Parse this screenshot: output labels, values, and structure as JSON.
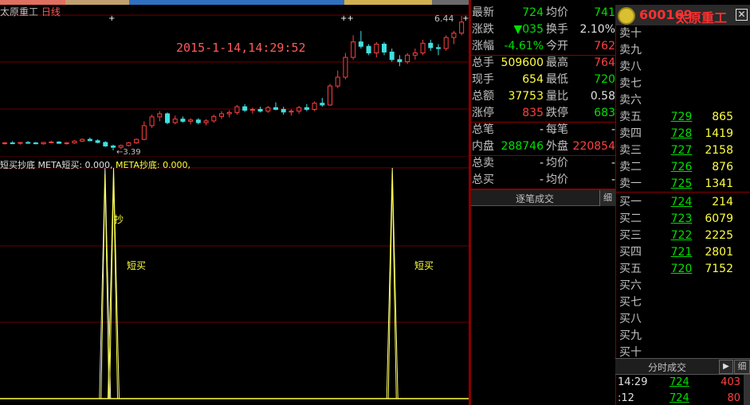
{
  "header": {
    "stock_name": "太原重工",
    "period": "日线",
    "cursor_datetime": "2015-1-14,14:29:52",
    "high_label": "6.44",
    "low_label": "3.39"
  },
  "indicator": {
    "name": "短买抄底",
    "meta_a": "META短买: 0.000,",
    "meta_b": "META抄底: 0.000,",
    "signals": [
      "抄",
      "短买",
      "短买"
    ]
  },
  "quote": {
    "rows": [
      {
        "l1": "最新",
        "v1": "724",
        "c1": "green",
        "l2": "均价",
        "v2": "741",
        "c2": "green"
      },
      {
        "l1": "涨跌",
        "v1": "▼035",
        "c1": "green",
        "l2": "换手",
        "v2": "2.10%",
        "c2": "white"
      },
      {
        "l1": "涨幅",
        "v1": "-4.61%",
        "c1": "green",
        "l2": "今开",
        "v2": "762",
        "c2": "red"
      },
      {
        "l1": "总手",
        "v1": "509600",
        "c1": "yellow",
        "l2": "最高",
        "v2": "764",
        "c2": "red"
      },
      {
        "l1": "现手",
        "v1": "654",
        "c1": "yellow",
        "l2": "最低",
        "v2": "720",
        "c2": "green"
      },
      {
        "l1": "总额",
        "v1": "37753",
        "c1": "yellow",
        "l2": "量比",
        "v2": "0.58",
        "c2": "white"
      },
      {
        "l1": "涨停",
        "v1": "835",
        "c1": "red",
        "l2": "跌停",
        "v2": "683",
        "c2": "green"
      },
      {
        "l1": "总笔",
        "v1": "-",
        "c1": "white",
        "l2": "每笔",
        "v2": "-",
        "c2": "white"
      },
      {
        "l1": "内盘",
        "v1": "288746",
        "c1": "green",
        "l2": "外盘",
        "v2": "220854",
        "c2": "red"
      },
      {
        "l1": "总卖",
        "v1": "-",
        "c1": "white",
        "l2": "均价",
        "v2": "-",
        "c2": "white"
      },
      {
        "l1": "总买",
        "v1": "-",
        "c1": "white",
        "l2": "均价",
        "v2": "-",
        "c2": "white"
      }
    ],
    "tick_title": "逐笔成交",
    "tick_detail_button": "细"
  },
  "orderbook": {
    "code": "600169",
    "name": "太原重工",
    "close_icon": "close-icon",
    "levels": [
      {
        "label": "卖十",
        "price": "",
        "vol": ""
      },
      {
        "label": "卖九",
        "price": "",
        "vol": ""
      },
      {
        "label": "卖八",
        "price": "",
        "vol": ""
      },
      {
        "label": "卖七",
        "price": "",
        "vol": ""
      },
      {
        "label": "卖六",
        "price": "",
        "vol": ""
      },
      {
        "label": "卖五",
        "price": "729",
        "vol": "865"
      },
      {
        "label": "卖四",
        "price": "728",
        "vol": "1419"
      },
      {
        "label": "卖三",
        "price": "727",
        "vol": "2158"
      },
      {
        "label": "卖二",
        "price": "726",
        "vol": "876"
      },
      {
        "label": "卖一",
        "price": "725",
        "vol": "1341"
      },
      {
        "label": "买一",
        "price": "724",
        "vol": "214"
      },
      {
        "label": "买二",
        "price": "723",
        "vol": "6079"
      },
      {
        "label": "买三",
        "price": "722",
        "vol": "2225"
      },
      {
        "label": "买四",
        "price": "721",
        "vol": "2801"
      },
      {
        "label": "买五",
        "price": "720",
        "vol": "7152"
      },
      {
        "label": "买六",
        "price": "",
        "vol": ""
      },
      {
        "label": "买七",
        "price": "",
        "vol": ""
      },
      {
        "label": "买八",
        "price": "",
        "vol": ""
      },
      {
        "label": "买九",
        "price": "",
        "vol": ""
      },
      {
        "label": "买十",
        "price": "",
        "vol": ""
      }
    ],
    "timeshare_title": "分时成交",
    "timeshare_play": "▶",
    "timeshare_detail": "细",
    "trades": [
      {
        "time": "14:29",
        "price": "724",
        "vol": "403"
      },
      {
        "time": ":12",
        "price": "724",
        "vol": "80"
      }
    ]
  },
  "chart_data": {
    "type": "candlestick",
    "title": "",
    "high": 6.44,
    "low": 3.39,
    "candles": [
      [
        3.55,
        3.58,
        3.52,
        3.56
      ],
      [
        3.56,
        3.6,
        3.53,
        3.55
      ],
      [
        3.55,
        3.58,
        3.52,
        3.57
      ],
      [
        3.57,
        3.6,
        3.54,
        3.56
      ],
      [
        3.56,
        3.58,
        3.53,
        3.54
      ],
      [
        3.54,
        3.58,
        3.52,
        3.57
      ],
      [
        3.57,
        3.61,
        3.55,
        3.58
      ],
      [
        3.58,
        3.6,
        3.54,
        3.55
      ],
      [
        3.55,
        3.58,
        3.52,
        3.56
      ],
      [
        3.56,
        3.62,
        3.54,
        3.6
      ],
      [
        3.6,
        3.66,
        3.58,
        3.64
      ],
      [
        3.64,
        3.68,
        3.6,
        3.61
      ],
      [
        3.61,
        3.64,
        3.55,
        3.57
      ],
      [
        3.57,
        3.6,
        3.47,
        3.49
      ],
      [
        3.49,
        3.52,
        3.39,
        3.46
      ],
      [
        3.46,
        3.52,
        3.42,
        3.5
      ],
      [
        3.5,
        3.58,
        3.48,
        3.56
      ],
      [
        3.56,
        3.66,
        3.54,
        3.64
      ],
      [
        3.64,
        4.05,
        3.62,
        3.95
      ],
      [
        3.95,
        4.2,
        3.9,
        4.15
      ],
      [
        4.15,
        4.28,
        4.05,
        4.22
      ],
      [
        4.22,
        4.25,
        3.98,
        4.02
      ],
      [
        4.02,
        4.18,
        3.98,
        4.1
      ],
      [
        4.1,
        4.16,
        4.02,
        4.05
      ],
      [
        4.05,
        4.12,
        3.98,
        4.08
      ],
      [
        4.08,
        4.12,
        3.98,
        4.02
      ],
      [
        4.02,
        4.1,
        3.96,
        4.06
      ],
      [
        4.06,
        4.2,
        4.02,
        4.16
      ],
      [
        4.16,
        4.28,
        4.1,
        4.22
      ],
      [
        4.22,
        4.3,
        4.14,
        4.25
      ],
      [
        4.25,
        4.42,
        4.2,
        4.38
      ],
      [
        4.38,
        4.44,
        4.26,
        4.3
      ],
      [
        4.3,
        4.36,
        4.22,
        4.32
      ],
      [
        4.32,
        4.38,
        4.25,
        4.28
      ],
      [
        4.28,
        4.4,
        4.24,
        4.36
      ],
      [
        4.36,
        4.48,
        4.3,
        4.32
      ],
      [
        4.32,
        4.38,
        4.2,
        4.26
      ],
      [
        4.26,
        4.32,
        4.18,
        4.28
      ],
      [
        4.28,
        4.4,
        4.22,
        4.36
      ],
      [
        4.36,
        4.44,
        4.28,
        4.32
      ],
      [
        4.32,
        4.5,
        4.28,
        4.46
      ],
      [
        4.46,
        4.58,
        4.38,
        4.42
      ],
      [
        4.42,
        4.9,
        4.4,
        4.85
      ],
      [
        4.85,
        5.2,
        4.8,
        5.05
      ],
      [
        5.05,
        5.6,
        5.0,
        5.5
      ],
      [
        5.5,
        6.0,
        5.45,
        5.85
      ],
      [
        5.85,
        6.1,
        5.7,
        5.75
      ],
      [
        5.75,
        5.8,
        5.55,
        5.6
      ],
      [
        5.6,
        5.85,
        5.5,
        5.8
      ],
      [
        5.8,
        5.85,
        5.55,
        5.62
      ],
      [
        5.62,
        5.7,
        5.4,
        5.45
      ],
      [
        5.45,
        5.55,
        5.3,
        5.4
      ],
      [
        5.4,
        5.6,
        5.35,
        5.55
      ],
      [
        5.55,
        5.7,
        5.45,
        5.6
      ],
      [
        5.6,
        5.9,
        5.55,
        5.82
      ],
      [
        5.82,
        5.9,
        5.65,
        5.72
      ],
      [
        5.72,
        5.8,
        5.55,
        5.7
      ],
      [
        5.7,
        6.0,
        5.65,
        5.95
      ],
      [
        5.95,
        6.1,
        5.8,
        6.05
      ],
      [
        6.05,
        6.44,
        6.0,
        6.3
      ]
    ],
    "signals": [
      {
        "index": 13,
        "kind": "抄"
      },
      {
        "index": 14,
        "kind": "短买"
      },
      {
        "index": 50,
        "kind": "短买"
      }
    ]
  }
}
